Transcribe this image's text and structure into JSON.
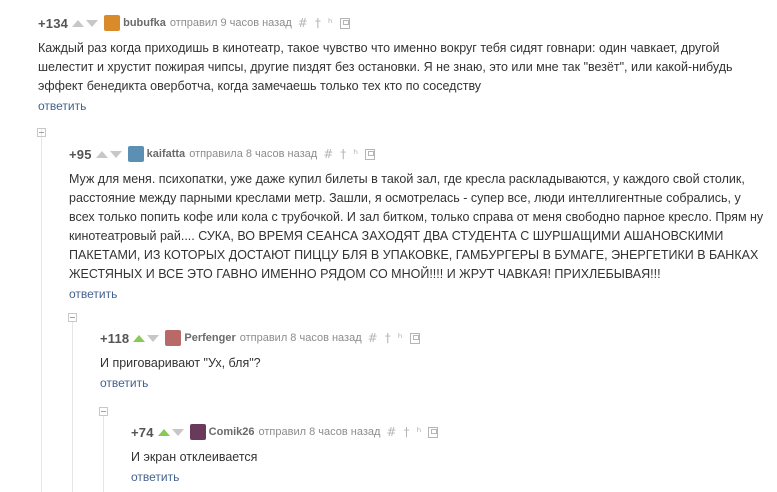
{
  "comments": [
    {
      "rating": "+134",
      "user": "bubufka",
      "avatar_color": "#d98b2b",
      "vote_up_active": false,
      "meta": "отправил 9 часов назад",
      "text": "Каждый раз когда приходишь в кинотеатр, такое чувство что именно вокруг тебя сидят говнари: один чавкает, другой шелестит и хрустит пожирая чипсы, другие пиздят без остановки. Я не знаю, это или мне так \"везёт\", или какой-нибудь эффект бенедикта оверботча, когда замечаешь только тех кто по соседству",
      "reply": "ответить"
    },
    {
      "rating": "+95",
      "user": "kaifatta",
      "avatar_color": "#5b8fb3",
      "vote_up_active": false,
      "meta": "отправила 8 часов назад",
      "text": "Муж для меня. психопатки, уже даже купил билеты в такой зал, где кресла раскладываются, у каждого свой столик, расстояние между парными креслами метр. Зашли, я осмотрелась - супер все, люди интеллигентные собрались, у всех только попить кофе или кола с трубочкой. И зал битком, только справа от меня свободно парное кресло. Прям ну кинотеатровый рай.... СУКА, ВО ВРЕМЯ СЕАНСА ЗАХОДЯТ ДВА СТУДЕНТА С ШУРШАЩИМИ АШАНОВСКИМИ ПАКЕТАМИ, ИЗ КОТОРЫХ ДОСТАЮТ ПИЦЦУ БЛЯ В УПАКОВКЕ, ГАМБУРГЕРЫ В БУМАГЕ, ЭНЕРГЕТИКИ В БАНКАХ ЖЕСТЯНЫХ И ВСЕ ЭТО ГАВНО ИМЕННО РЯДОМ СО МНОЙ!!!! И ЖРУТ ЧАВКАЯ! ПРИХЛЕБЫВАЯ!!!",
      "reply": "ответить"
    },
    {
      "rating": "+118",
      "user": "Perfenger",
      "avatar_color": "#b86a6a",
      "vote_up_active": true,
      "meta": "отправил 8 часов назад",
      "text": "И приговаривают \"Ух, бля\"?",
      "reply": "ответить"
    },
    {
      "rating": "+74",
      "user": "Comik26",
      "avatar_color": "#6a3a5a",
      "vote_up_active": true,
      "meta": "отправил 8 часов назад",
      "text": "И экран отклеивается",
      "reply": "ответить"
    }
  ],
  "tools": {
    "hash": "#",
    "pin": "†",
    "tree": "ʰ"
  },
  "colors": {
    "reply_link": "#43618f",
    "vote_active": "#8ac858",
    "vote_inactive": "#c7c7c7"
  }
}
